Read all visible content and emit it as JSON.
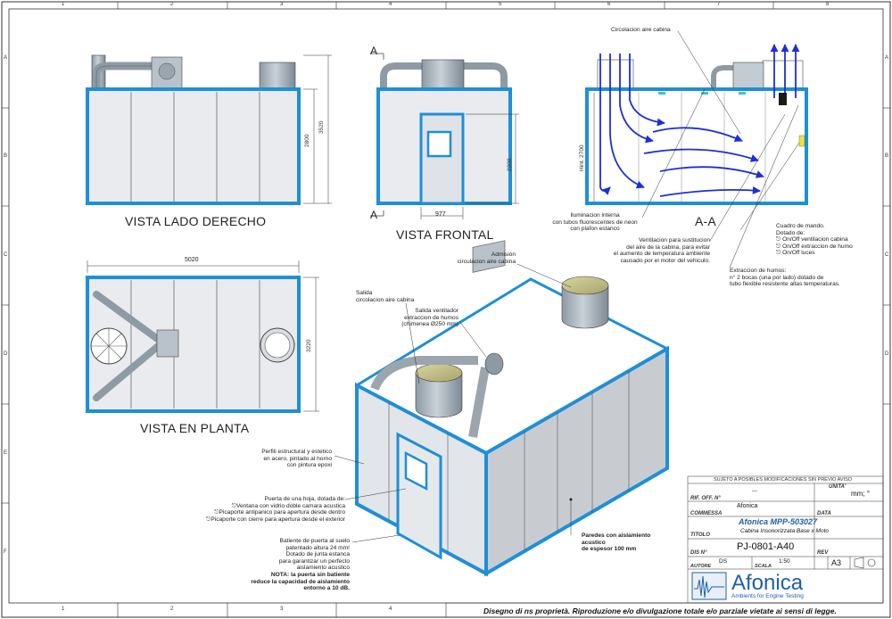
{
  "grid": {
    "columns": [
      "1",
      "2",
      "3",
      "4",
      "5",
      "6",
      "7",
      "8"
    ],
    "rows": [
      "A",
      "B",
      "C",
      "D",
      "E",
      "F"
    ]
  },
  "views": {
    "side_right": {
      "title": "VISTA LADO DERECHO",
      "dim_total": "3520",
      "dim_body": "2800"
    },
    "front": {
      "title": "VISTA FRONTAL",
      "marker": "A",
      "dim_height": "2200",
      "dim_width": "977"
    },
    "section": {
      "title": "A-A",
      "label_top": "Circolacion aire cabina",
      "dim_height": "Hint. 2700",
      "note_lighting": [
        "Iluminacion interna",
        "con tubos fluorescentes de neon",
        "con plafon estanco"
      ],
      "note_ventilation": [
        "Ventilacion para sustitucion",
        "del aire de la cabina, para evitar",
        "el aumento de temperatura ambiente",
        "causado por el motor del vehiculo."
      ],
      "note_control_title": [
        "Cuadro de mando.",
        "Dotado de:"
      ],
      "note_control_items": [
        "On/Off ventilacion cabina",
        "On/Off extraccion de humo",
        "On/Off luces"
      ],
      "note_extraction": [
        "Extraccion de humos:",
        "n° 2 bocas (una por lado) dotado de",
        "tubo flexible resistente altas temperaturas."
      ]
    },
    "plan": {
      "title": "VISTA EN PLANTA",
      "dim_width": "5020",
      "dim_depth": "3220"
    },
    "iso": {
      "note_admission": [
        "Admisión",
        "circulacion aire cabina"
      ],
      "note_outlet": [
        "Salida",
        "circolacion aire cabina"
      ],
      "note_fan": [
        "Salida ventilador",
        "extraccion de humos",
        "(chimenea Ø250 mm)"
      ],
      "note_profiles": [
        "Perfili estructural y estetico",
        "en acero, pintado al horno",
        "con pintura epoxi"
      ],
      "note_door_title": "Puerta de una hoja, dotada de:",
      "note_door_items": [
        "Ventana con vidrio doble camara acustica",
        "Picaporte antipanico para apertura desde dentro",
        "Picaporte con cierre para apertura desde el exterior"
      ],
      "note_threshold": [
        "Batiente de puerta al suelo",
        "patentado altura 24 mm!",
        "Dotado de junta estanca",
        "para garantizar un perfecto",
        "aislamiento acustico"
      ],
      "note_threshold_bold": [
        "NOTA: la puerta sin batiente",
        "reduce la capacidad de aislamiento",
        "entorno a 10 dB."
      ],
      "note_walls": [
        "Paredes con aislamiento",
        "acustico",
        "de espesor 100 mm"
      ]
    }
  },
  "title_block": {
    "header": "SUJETO A POSIBLES MODIFICACIONES SIN PREVIO AVISO",
    "rif_label": "RIF. OFF. N°",
    "rif_value": "---",
    "unit_label": "UNITA'",
    "unit_value": "mm; °",
    "commessa_label": "COMMESSA",
    "commessa_value": "Afonica",
    "data_label": "DATA",
    "product": "Afonica MPP-503027",
    "titolo_label": "TITOLO",
    "titolo_value": "Cabina Insonorizzata Base x Moto",
    "dis_label": "DIS N°",
    "dis_value": "PJ-0801-A40",
    "rev_label": "REV",
    "autore_label": "AUTORE",
    "autore_value": "DS",
    "scala_label": "SCALA",
    "scala_value": "1:50",
    "format_value": "A3",
    "logo_name": "Afonica",
    "logo_tagline": "Ambients for Engine Testing",
    "copyright": "Disegno di ns proprietà. Riproduzione e/o divulgazione totale e/o parziale vietate ai sensi di legge."
  },
  "colors": {
    "frame_blue": "#1e8fd8",
    "panel_grey": "#e9ebee",
    "chimney_grey": "#aab4bd",
    "arrow_blue": "#1c2fd8",
    "logo_blue": "#1f5fa8"
  }
}
